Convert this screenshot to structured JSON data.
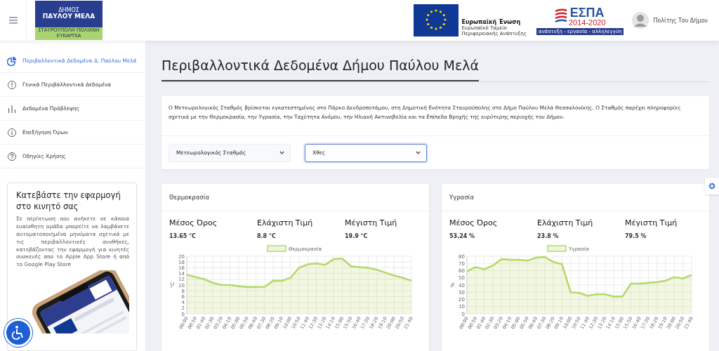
{
  "header": {
    "logo": {
      "top": "ΔΗΜΟΣ",
      "name": "ΠΑΥΛΟΥ ΜΕΛΑ",
      "strip": "ΣΤΑΥΡΟΥΠΟΛΗ ΠΟΛΙΧΝΗ ΕΥΚΑΡΠΙΑ"
    },
    "eu": {
      "title": "Ευρωπαϊκή Ένωση",
      "subtitle": [
        "Ευρωπαϊκό Ταμείο",
        "Περιφερειακής Ανάπτυξης"
      ]
    },
    "espa": {
      "name": "ΕΣΠΑ",
      "years": "2014-2020",
      "motto": "ανάπτυξη - εργασία - αλληλεγγύη"
    },
    "user": {
      "name": "Πολίτης Του Δήμου"
    }
  },
  "sidebar": {
    "items": [
      {
        "label": "Περιβαλλοντικά Δεδομένα Δ. Παύλου Μελά",
        "kind": "pie",
        "selected": true
      },
      {
        "label": "Γενικά Περιβαλλοντικά Δεδομένα",
        "kind": "alert",
        "selected": false
      },
      {
        "label": "Δεδομένα Πρόβλεψης",
        "kind": "bars",
        "selected": false
      },
      {
        "label": "Επεξήγηση Όρων",
        "kind": "info",
        "selected": false
      },
      {
        "label": "Οδηγίες Χρήσης",
        "kind": "help",
        "selected": false
      }
    ],
    "promo": {
      "title": "Κατεβάστε την εφαρμογή στο κινητό σας",
      "text": "Σε περίπτωση που ανήκετε σε κάποια ευαίσθητη ομάδα μπορείτε να λαμβάνετε αυτοματοποιημένα μηνύματα σχετικά με τις περιβαλλοντικές συνθήκες, κατεβάζοντας την εφαρμογή για κινητές συσκευές απο το Apple App Store ή από το Google Play Store"
    }
  },
  "page": {
    "title": "Περιβαλλοντικά Δεδομένα Δήμου Παύλου Μελά",
    "description": "Ο Μετεωρολογικός Σταθμός βρίσκεται εγκατεστημένος στο Πάρκο Δενδροποτάμου, στη Δημοτική Ενότητα Σταυρούπολης στο Δήμο Παύλου Μελά Θεσσαλονίκης. Ο Σταθμός παρέχει πληροφορίες σχετικά με την Θερμοκρασία, την Υγρασία, την Ταχύτητα Ανέμου, την Ηλιακή Ακτινοβολία και τα Επίπεδα Βροχής της ευρύτερης περιοχής του Δήμου.",
    "selects": [
      {
        "value": "Μετεωρολογικός Σταθμός",
        "focused": false
      },
      {
        "value": "Χθες",
        "focused": true
      }
    ],
    "cards": [
      {
        "title": "Θερμοκρασία",
        "stats": [
          {
            "label": "Μέσος Όρος",
            "value": "13.65 °C"
          },
          {
            "label": "Ελάχιστη Τιμή",
            "value": "8.8 °C"
          },
          {
            "label": "Μέγιστη Τιμή",
            "value": "19.9 °C"
          }
        ],
        "chart_data": {
          "type": "area",
          "grid": true,
          "ylabel": "°C",
          "ylim": [
            0,
            20
          ],
          "yticks": [
            0,
            2,
            4,
            6,
            8,
            10,
            12,
            14,
            16,
            18,
            20
          ],
          "categories": [
            "00:00",
            "00:50",
            "01:40",
            "02:30",
            "03:20",
            "04:10",
            "05:00",
            "05:50",
            "06:40",
            "07:30",
            "08:20",
            "09:10",
            "10:00",
            "10:50",
            "11:40",
            "12:30",
            "13:20",
            "14:10",
            "15:00",
            "15:50",
            "16:40",
            "17:30",
            "18:20",
            "19:10",
            "20:00",
            "20:50",
            "21:40"
          ],
          "series": [
            {
              "name": "Θερμοκρασία",
              "color": "#b7d96b",
              "values": [
                13.5,
                12.8,
                12,
                10.8,
                10,
                10,
                9.6,
                9.3,
                9.3,
                9.4,
                11.5,
                11.5,
                12.5,
                16,
                17.2,
                17.5,
                17,
                19,
                19.2,
                16.5,
                16.2,
                16,
                15.3,
                14.3,
                13.3,
                12.5,
                11.5
              ]
            }
          ]
        }
      },
      {
        "title": "Υγρασία",
        "stats": [
          {
            "label": "Μέσος Όρος",
            "value": "53.24 %"
          },
          {
            "label": "Ελάχιστη Τιμή",
            "value": "23.8 %"
          },
          {
            "label": "Μέγιστη Τιμή",
            "value": "79.5 %"
          }
        ],
        "chart_data": {
          "type": "area",
          "grid": true,
          "ylabel": "%",
          "ylim": [
            0,
            80
          ],
          "yticks": [
            0,
            10,
            20,
            30,
            40,
            50,
            60,
            70,
            80
          ],
          "categories": [
            "00:00",
            "00:50",
            "01:40",
            "02:30",
            "03:20",
            "04:10",
            "05:00",
            "05:50",
            "06:40",
            "07:30",
            "08:20",
            "09:10",
            "10:00",
            "10:50",
            "11:40",
            "12:30",
            "13:20",
            "14:10",
            "15:00",
            "15:50",
            "16:40",
            "17:30",
            "18:20",
            "19:10",
            "20:00",
            "20:50",
            "21:40"
          ],
          "series": [
            {
              "name": "Υγρασία",
              "color": "#b7d96b",
              "values": [
                59,
                65,
                62,
                67,
                76,
                75,
                75,
                74,
                78,
                79,
                72,
                69,
                30,
                29,
                25,
                27,
                27,
                24,
                24,
                42,
                42,
                43,
                44,
                46,
                51,
                49,
                54
              ]
            }
          ]
        }
      }
    ]
  }
}
